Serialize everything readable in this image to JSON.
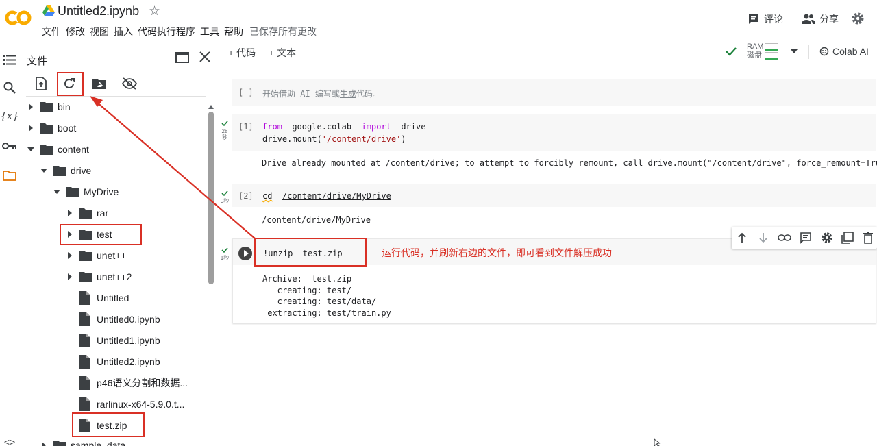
{
  "header": {
    "title": "Untitled2.ipynb",
    "menu": [
      "文件",
      "修改",
      "视图",
      "插入",
      "代码执行程序",
      "工具",
      "帮助"
    ],
    "saved_status": "已保存所有更改",
    "comment_label": "评论",
    "share_label": "分享"
  },
  "colors": {
    "accent_orange": "#f9ab00",
    "annotation_red": "#d93025",
    "ok_green": "#188038",
    "keyword_purple": "#af00db"
  },
  "files_panel": {
    "title": "文件",
    "tree": [
      {
        "label": "bin",
        "type": "folder",
        "expanded": false
      },
      {
        "label": "boot",
        "type": "folder",
        "expanded": false
      },
      {
        "label": "content",
        "type": "folder",
        "expanded": true
      },
      {
        "label": "drive",
        "type": "folder",
        "expanded": true
      },
      {
        "label": "MyDrive",
        "type": "folder",
        "expanded": true
      },
      {
        "label": "rar",
        "type": "folder",
        "expanded": false
      },
      {
        "label": "test",
        "type": "folder",
        "expanded": false
      },
      {
        "label": "unet++",
        "type": "folder",
        "expanded": false
      },
      {
        "label": "unet++2",
        "type": "folder",
        "expanded": false
      },
      {
        "label": "Untitled",
        "type": "file"
      },
      {
        "label": "Untitled0.ipynb",
        "type": "file"
      },
      {
        "label": "Untitled1.ipynb",
        "type": "file"
      },
      {
        "label": "Untitled2.ipynb",
        "type": "file"
      },
      {
        "label": "p46语义分割和数据...",
        "type": "file"
      },
      {
        "label": "rarlinux-x64-5.9.0.t...",
        "type": "file"
      },
      {
        "label": "test.zip",
        "type": "file"
      },
      {
        "label": "sample_data",
        "type": "folder",
        "expanded": false
      }
    ]
  },
  "notebook_toolbar": {
    "add_code": "+ 代码",
    "add_text": "+ 文本",
    "ram_label": "RAM",
    "disk_label": "磁盘",
    "colab_ai": "Colab AI"
  },
  "cells": {
    "empty": {
      "prompt": "[ ]",
      "placeholder_a": "开始借助 AI 编写或",
      "placeholder_link": "生成",
      "placeholder_b": "代码。"
    },
    "c1": {
      "prompt": "[1]",
      "exec_time": "28",
      "exec_unit": "秒",
      "kw_from": "from",
      "mod": "google.colab",
      "kw_import": "import",
      "name": "drive",
      "call": "drive.mount(",
      "arg": "'/content/drive'",
      "close": ")",
      "output": "Drive already mounted at /content/drive; to attempt to forcibly remount, call drive.mount(\"/content/drive\", force_remount=True)."
    },
    "c2": {
      "prompt": "[2]",
      "exec_time": "0秒",
      "cmd": "cd",
      "path": "/content/drive/MyDrive",
      "output": "/content/drive/MyDrive"
    },
    "c3": {
      "exec_time": "1秒",
      "code": "!unzip  test.zip",
      "output": [
        "Archive:  test.zip",
        "   creating: test/",
        "   creating: test/data/",
        " extracting: test/train.py"
      ]
    }
  },
  "annotation": "运行代码，并刷新右边的文件，即可看到文件解压成功"
}
